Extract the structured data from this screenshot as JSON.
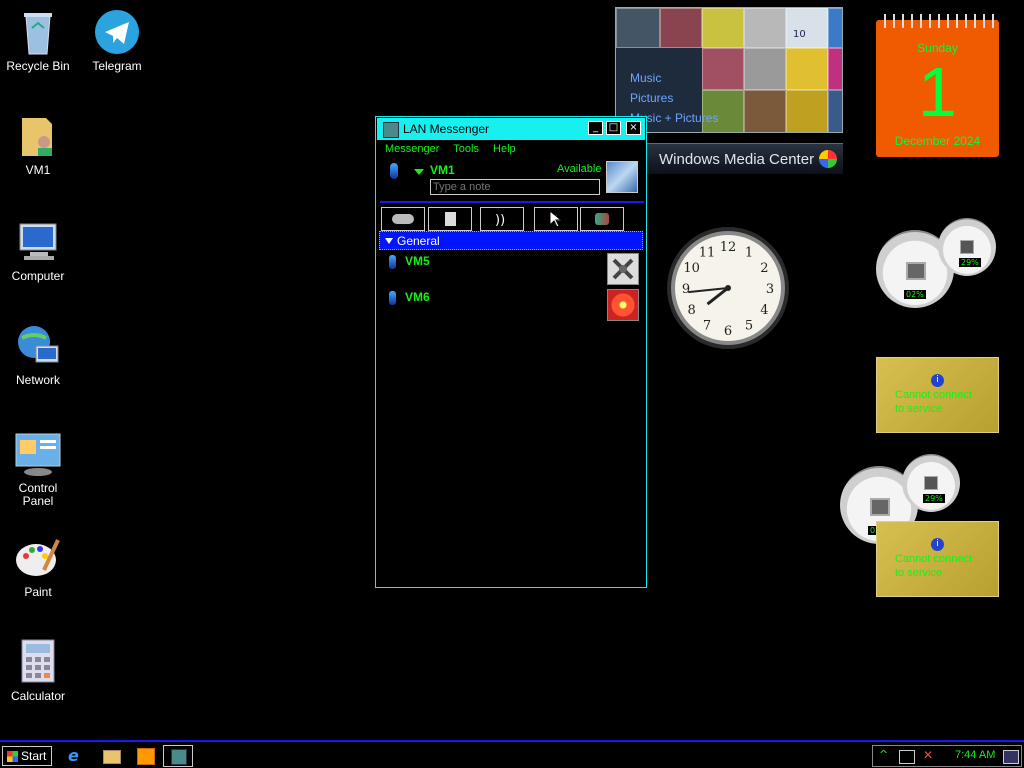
{
  "desktop": {
    "icons": [
      {
        "label": "Recycle Bin"
      },
      {
        "label": "Telegram"
      },
      {
        "label": "VM1"
      },
      {
        "label": "Computer"
      },
      {
        "label": "Network"
      },
      {
        "label": "Control Panel"
      },
      {
        "label": "Paint"
      },
      {
        "label": "Calculator"
      }
    ]
  },
  "media_center": {
    "menu": [
      "Music",
      "Pictures",
      "Music + Pictures"
    ],
    "title": "Windows Media Center",
    "tile_text": "10"
  },
  "calendar": {
    "weekday": "Sunday",
    "day": "1",
    "month": "December 2024"
  },
  "clock": {
    "numerals": [
      "12",
      "1",
      "2",
      "3",
      "4",
      "5",
      "6",
      "7",
      "8",
      "9",
      "10",
      "11"
    ],
    "hour": 7,
    "minute": 44
  },
  "messenger": {
    "title": "LAN Messenger",
    "menu": [
      "Messenger",
      "Tools",
      "Help"
    ],
    "user": {
      "name": "VM1",
      "status": "Available",
      "note_placeholder": "Type a note"
    },
    "group": "General",
    "contacts": [
      {
        "name": "VM5"
      },
      {
        "name": "VM6"
      }
    ]
  },
  "gauges": {
    "cpu_1": "02%",
    "mem_1": "29%",
    "cpu_2": "02%",
    "mem_2": "29%"
  },
  "info_widgets": [
    {
      "message": "Cannot connect\nto service"
    },
    {
      "message": "Cannot connect\nto service"
    }
  ],
  "taskbar": {
    "start_label": "Start",
    "time": "7:44 AM"
  },
  "colors": {
    "accent": "#18f0f0",
    "green": "#18f018",
    "blue": "#0014ff",
    "calendar": "#f05a00"
  }
}
